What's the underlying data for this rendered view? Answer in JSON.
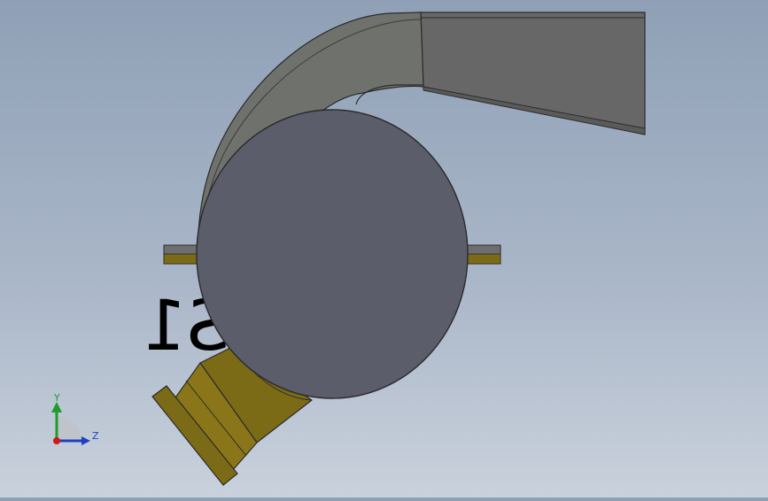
{
  "viewport": {
    "background_top": "#8fa0b6",
    "background_bottom": "#c9d1dc",
    "model": {
      "body_color": "#5b5d6b",
      "duct_color": "#6a6a6a",
      "volute_color": "#70736d",
      "flange_color": "#7b6a16",
      "edge_color": "#2b2b2b",
      "shaft_color": "#6f6f6f",
      "mirrored_text": "S1"
    }
  },
  "triad": {
    "y_label": "Y",
    "z_label": "Z",
    "y_color": "#1f9c2a",
    "z_color": "#1f3fc0",
    "x_color": "#d01818",
    "icons": [
      "y-axis-arrow-icon",
      "z-axis-arrow-icon",
      "origin-icon"
    ]
  }
}
